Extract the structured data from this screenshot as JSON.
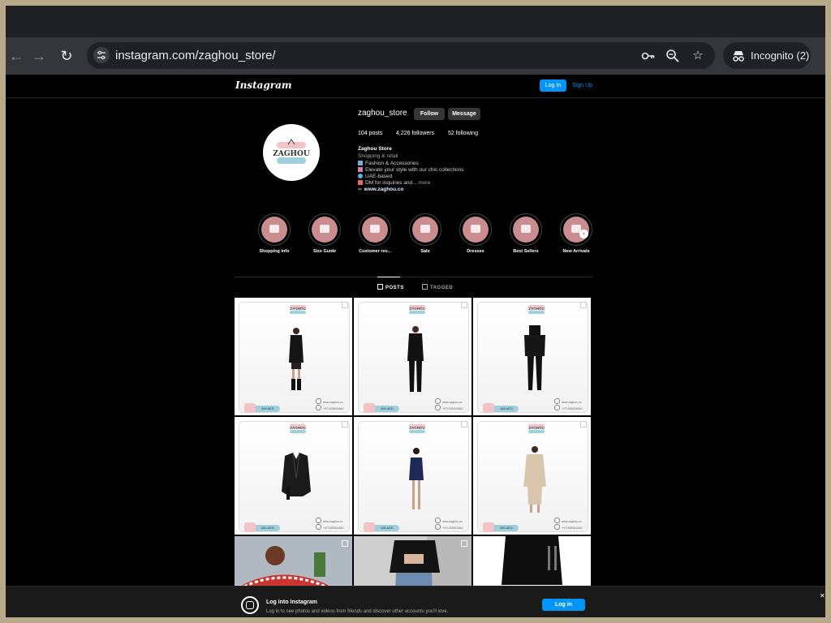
{
  "browser": {
    "url": "instagram.com/zaghou_store/",
    "incognito_label": "Incognito (2)"
  },
  "ig": {
    "logo": "Instagram",
    "login": "Log In",
    "signup": "Sign Up"
  },
  "profile": {
    "avatar_text": "ZAGHOU",
    "username": "zaghou_store",
    "follow": "Follow",
    "message": "Message",
    "posts": "104 posts",
    "followers": "4,226 followers",
    "following": "52 following",
    "name": "Zaghou Store",
    "category": "Shopping & retail",
    "bio1": "Fashion & Accessories",
    "bio2": "Elevate your style with our chic collections",
    "bio3": "UAE-based",
    "bio4": "DM for inquiries and...",
    "more": "more",
    "link": "www.zaghou.co"
  },
  "highlights": [
    "Shopping info",
    "Size Guide",
    "Customer rev...",
    "Sale",
    "Dresses",
    "Best Sellers",
    "New Arrivals"
  ],
  "tabs": {
    "posts": "POSTS",
    "tagged": "TAGGED"
  },
  "tile": {
    "brand": "ZAGHOU",
    "web": "www.zaghou.co",
    "phone": "+971505924640",
    "prices": [
      "399 AED",
      "399 AED",
      "185 AED",
      "360 AED",
      "165 AED",
      "350 AED"
    ]
  },
  "banner": {
    "title": "Log into Instagram",
    "subtitle": "Log in to see photos and videos from friends and discover other accounts you'll love.",
    "button": "Log in"
  },
  "colors": {
    "link": "#0095f6",
    "highlight": "#c98d8f"
  }
}
